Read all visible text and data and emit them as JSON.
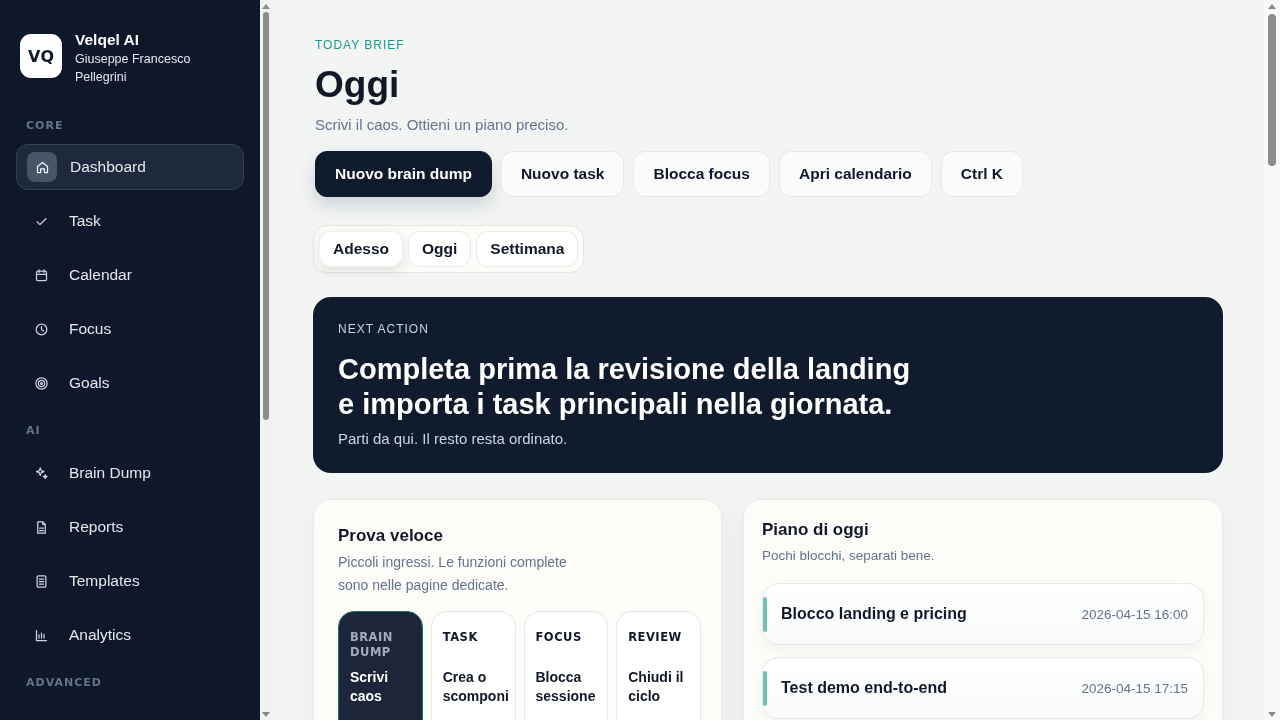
{
  "sidebar": {
    "brand": {
      "logo": "VQ",
      "name": "Velqel AI",
      "user": "Giuseppe Francesco Pellegrini"
    },
    "sections": [
      {
        "label": "CORE",
        "items": [
          {
            "label": "Dashboard",
            "selected": true
          },
          {
            "label": "Task",
            "selected": false
          },
          {
            "label": "Calendar",
            "selected": false
          },
          {
            "label": "Focus",
            "selected": false
          },
          {
            "label": "Goals",
            "selected": false
          }
        ]
      },
      {
        "label": "AI",
        "items": [
          {
            "label": "Brain Dump",
            "selected": false
          },
          {
            "label": "Reports",
            "selected": false
          },
          {
            "label": "Templates",
            "selected": false
          },
          {
            "label": "Analytics",
            "selected": false
          }
        ]
      },
      {
        "label": "ADVANCED"
      }
    ]
  },
  "header": {
    "eyebrow": "TODAY BRIEF",
    "title": "Oggi",
    "subtitle": "Scrivi il caos. Ottieni un piano preciso."
  },
  "actions": [
    {
      "label": "Nuovo brain dump",
      "kind": "primary"
    },
    {
      "label": "Nuovo task",
      "kind": "secondary"
    },
    {
      "label": "Blocca focus",
      "kind": "secondary"
    },
    {
      "label": "Apri calendario",
      "kind": "secondary"
    },
    {
      "label": "Ctrl K",
      "kind": "secondary"
    }
  ],
  "range_tabs": [
    {
      "label": "Adesso",
      "selected": true
    },
    {
      "label": "Oggi",
      "selected": false
    },
    {
      "label": "Settimana",
      "selected": false
    }
  ],
  "next_action": {
    "eyebrow": "NEXT ACTION",
    "title": "Completa prima la revisione della landing e importa i task principali nella giornata.",
    "subtitle": "Parti da qui. Il resto resta ordinato."
  },
  "quick_try": {
    "title": "Prova veloce",
    "description": "Piccoli ingressi. Le funzioni complete sono nelle pagine dedicate.",
    "tiles": [
      {
        "label": "BRAIN DUMP",
        "title": "Scrivi caos",
        "selected": true
      },
      {
        "label": "TASK",
        "title": "Crea o scomponi",
        "selected": false
      },
      {
        "label": "FOCUS",
        "title": "Blocca sessione",
        "selected": false
      },
      {
        "label": "REVIEW",
        "title": "Chiudi il ciclo",
        "selected": false
      }
    ]
  },
  "today_plan": {
    "title": "Piano di oggi",
    "description": "Pochi blocchi, separati bene.",
    "blocks": [
      {
        "title": "Blocco landing e pricing",
        "time": "2026-04-15 16:00"
      },
      {
        "title": "Test demo end-to-end",
        "time": "2026-04-15 17:15"
      }
    ]
  }
}
